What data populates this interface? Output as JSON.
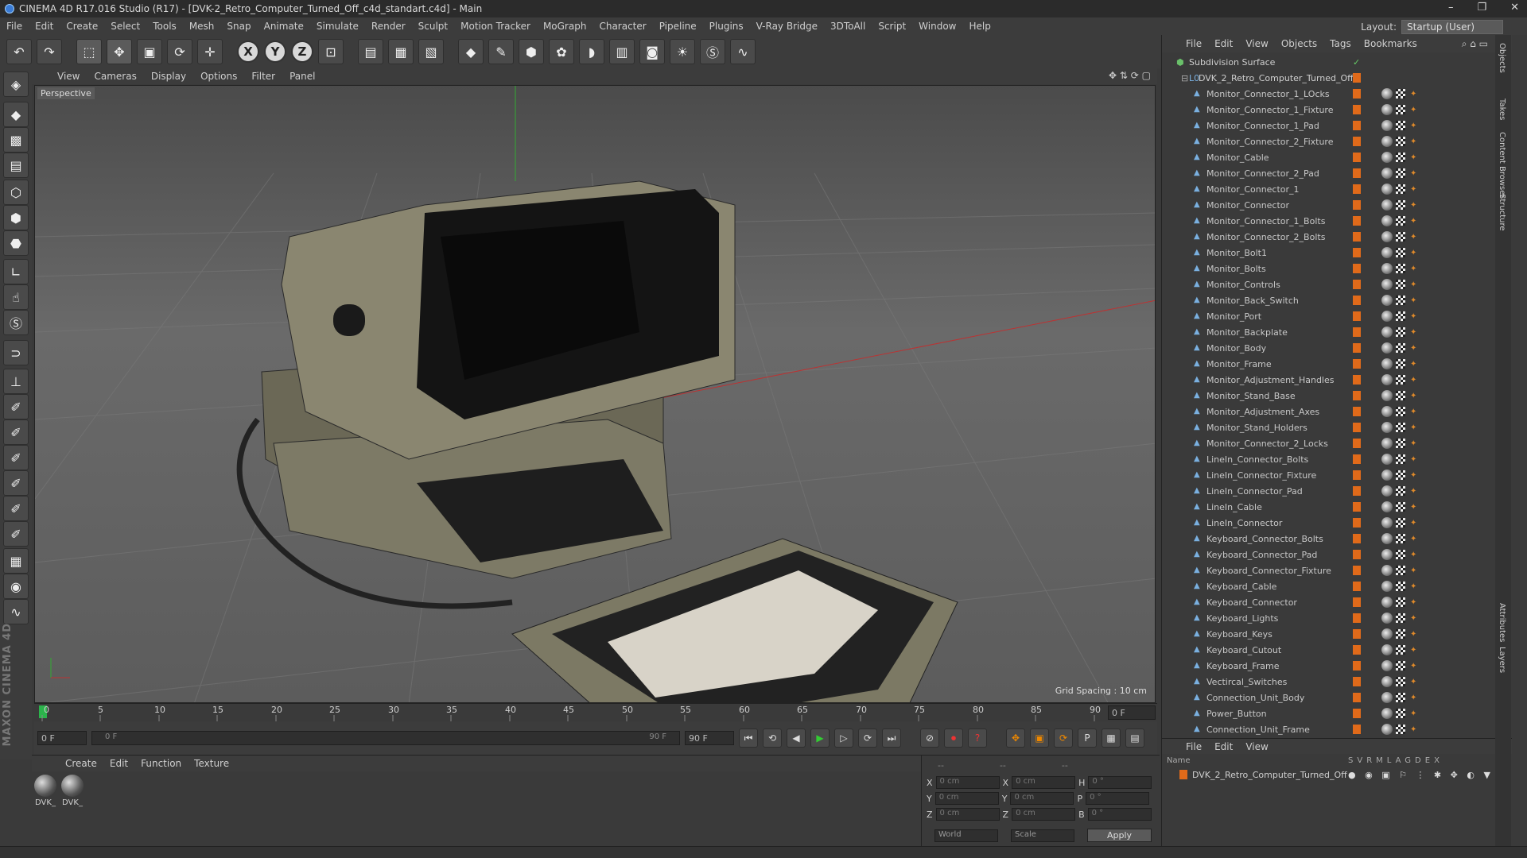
{
  "titlebar": {
    "title": "CINEMA 4D R17.016 Studio (R17) - [DVK-2_Retro_Computer_Turned_Off_c4d_standart.c4d] - Main"
  },
  "menubar": {
    "items": [
      "File",
      "Edit",
      "Create",
      "Select",
      "Tools",
      "Mesh",
      "Snap",
      "Animate",
      "Simulate",
      "Render",
      "Sculpt",
      "Motion Tracker",
      "MoGraph",
      "Character",
      "Pipeline",
      "Plugins",
      "V-Ray Bridge",
      "3DToAll",
      "Script",
      "Window",
      "Help"
    ],
    "layout_label": "Layout:",
    "layout_value": "Startup (User)"
  },
  "toolbar": {
    "axis_x": "X",
    "axis_y": "Y",
    "axis_z": "Z"
  },
  "viewport": {
    "menu": [
      "View",
      "Cameras",
      "Display",
      "Options",
      "Filter",
      "Panel"
    ],
    "camera_label": "Perspective",
    "grid_spacing": "Grid Spacing : 10 cm"
  },
  "timeline": {
    "ticks": [
      "0",
      "5",
      "10",
      "15",
      "20",
      "25",
      "30",
      "35",
      "40",
      "45",
      "50",
      "55",
      "60",
      "65",
      "70",
      "75",
      "80",
      "85",
      "90"
    ],
    "current_frame_right": "0 F"
  },
  "transport": {
    "start_field": "0 F",
    "range_start": "0 F",
    "range_end": "90 F",
    "end_field": "90 F"
  },
  "materials": {
    "menu": [
      "Create",
      "Edit",
      "Function",
      "Texture"
    ],
    "items": [
      {
        "name": "DVK_"
      },
      {
        "name": "DVK_"
      }
    ]
  },
  "coordinates": {
    "header": [
      "--",
      "--",
      "--"
    ],
    "rows": [
      {
        "a": "X",
        "v1": "0 cm",
        "b": "X",
        "v2": "0 cm",
        "c": "H",
        "v3": "0 °"
      },
      {
        "a": "Y",
        "v1": "0 cm",
        "b": "Y",
        "v2": "0 cm",
        "c": "P",
        "v3": "0 °"
      },
      {
        "a": "Z",
        "v1": "0 cm",
        "b": "Z",
        "v2": "0 cm",
        "c": "B",
        "v3": "0 °"
      }
    ],
    "world": "World",
    "scale": "Scale",
    "apply": "Apply"
  },
  "objects": {
    "menu": [
      "File",
      "Edit",
      "View",
      "Objects",
      "Tags",
      "Bookmarks"
    ],
    "root": "Subdivision Surface",
    "group": "DVK_2_Retro_Computer_Turned_Off",
    "items": [
      "Monitor_Connector_1_LOcks",
      "Monitor_Connector_1_Fixture",
      "Monitor_Connector_1_Pad",
      "Monitor_Connector_2_Fixture",
      "Monitor_Cable",
      "Monitor_Connector_2_Pad",
      "Monitor_Connector_1",
      "Monitor_Connector",
      "Monitor_Connector_1_Bolts",
      "Monitor_Connector_2_Bolts",
      "Monitor_Bolt1",
      "Monitor_Bolts",
      "Monitor_Controls",
      "Monitor_Back_Switch",
      "Monitor_Port",
      "Monitor_Backplate",
      "Monitor_Body",
      "Monitor_Frame",
      "Monitor_Adjustment_Handles",
      "Monitor_Stand_Base",
      "Monitor_Adjustment_Axes",
      "Monitor_Stand_Holders",
      "Monitor_Connector_2_Locks",
      "LineIn_Connector_Bolts",
      "LineIn_Connector_Fixture",
      "LineIn_Connector_Pad",
      "LineIn_Cable",
      "LineIn_Connector",
      "Keyboard_Connector_Bolts",
      "Keyboard_Connector_Pad",
      "Keyboard_Connector_Fixture",
      "Keyboard_Cable",
      "Keyboard_Connector",
      "Keyboard_Lights",
      "Keyboard_Keys",
      "Keyboard_Cutout",
      "Keyboard_Frame",
      "Vectircal_Switches",
      "Connection_Unit_Body",
      "Power_Button",
      "Connection_Unit_Frame"
    ]
  },
  "layers": {
    "menu": [
      "File",
      "Edit",
      "View"
    ],
    "header_name": "Name",
    "header_cols": [
      "S",
      "V",
      "R",
      "M",
      "L",
      "A",
      "G",
      "D",
      "E",
      "X"
    ],
    "row": "DVK_2_Retro_Computer_Turned_Off"
  },
  "sidetabs": [
    "Objects",
    "Takes",
    "Content Browser",
    "Structure",
    "Attributes",
    "Layers"
  ],
  "colors": {
    "accent_orange": "#e06a1a",
    "selection_blue": "#3a7bd5"
  }
}
